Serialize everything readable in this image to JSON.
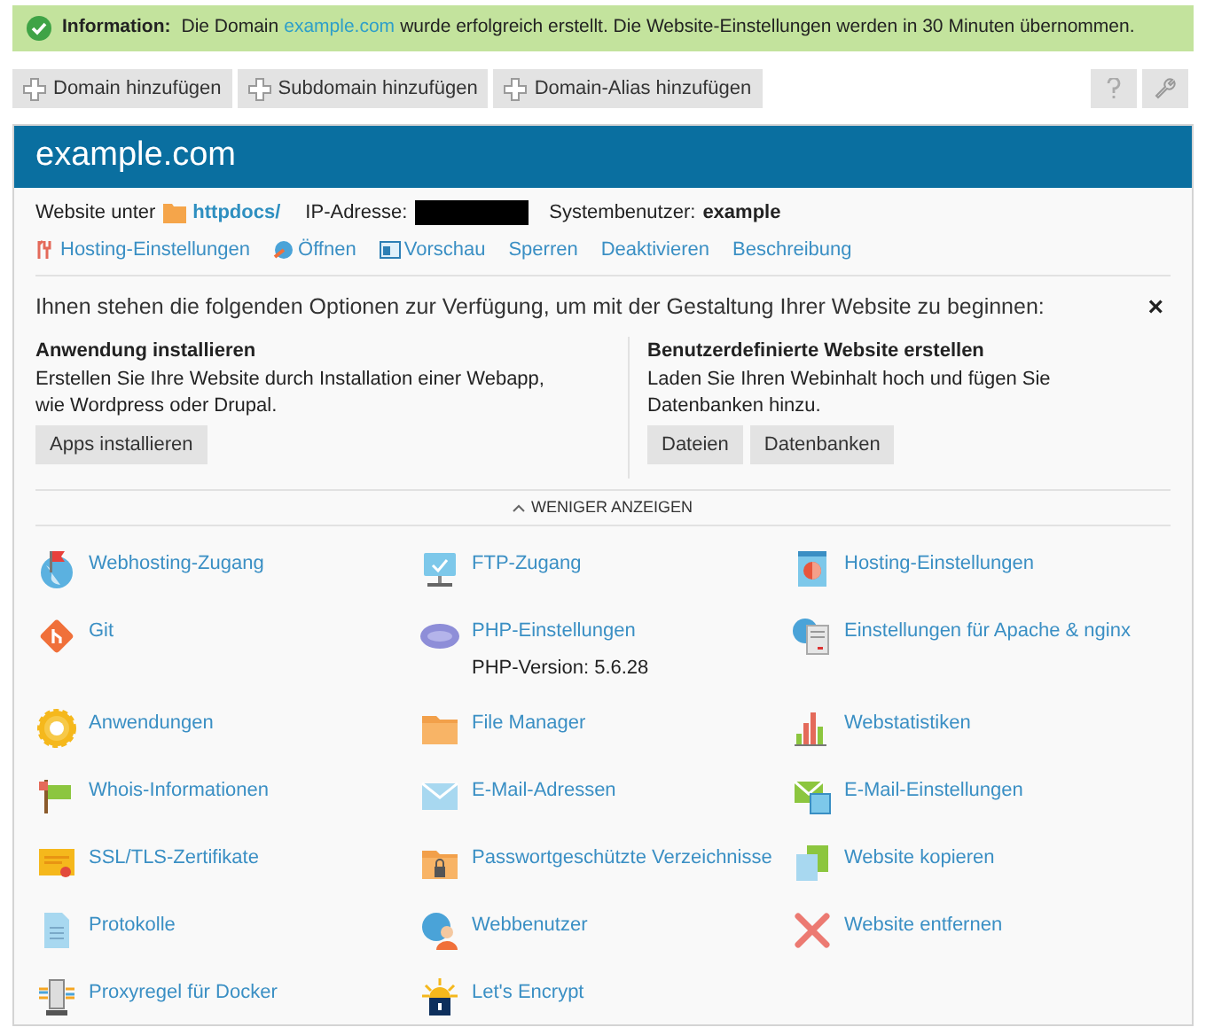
{
  "notice": {
    "label": "Information:",
    "before": "Die Domain",
    "link": "example.com",
    "after": "wurde erfolgreich erstellt. Die Website-Einstellungen werden in 30 Minuten übernommen."
  },
  "toolbar": [
    "Domain hinzufügen",
    "Subdomain hinzufügen",
    "Domain-Alias hinzufügen"
  ],
  "domain": {
    "title": "example.com",
    "website_label": "Website unter",
    "website_path": "httpdocs/",
    "ip_label": "IP-Adresse:",
    "user_label": "Systembenutzer:",
    "user": "example"
  },
  "actions": [
    "Hosting-Einstellungen",
    "Öffnen",
    "Vorschau",
    "Sperren",
    "Deaktivieren",
    "Beschreibung"
  ],
  "options": {
    "intro": "Ihnen stehen die folgenden Optionen zur Verfügung, um mit der Gestaltung Ihrer Website zu beginnen:",
    "close": "×",
    "left": {
      "title": "Anwendung installieren",
      "text": "Erstellen Sie Ihre Website durch Installation einer Webapp, wie Wordpress oder Drupal.",
      "buttons": [
        "Apps installieren"
      ]
    },
    "right": {
      "title": "Benutzerdefinierte Website erstellen",
      "text": "Laden Sie Ihren Webinhalt hoch und fügen Sie Datenbanken hinzu.",
      "buttons": [
        "Dateien",
        "Datenbanken"
      ]
    },
    "toggle": "WENIGER ANZEIGEN"
  },
  "tools": [
    {
      "label": "Webhosting-Zugang"
    },
    {
      "label": "FTP-Zugang"
    },
    {
      "label": "Hosting-Einstellungen"
    },
    {
      "label": "Git"
    },
    {
      "label": "PHP-Einstellungen",
      "note": "PHP-Version: 5.6.28"
    },
    {
      "label": "Einstellungen für Apache & nginx"
    },
    {
      "label": "Anwendungen"
    },
    {
      "label": "File Manager"
    },
    {
      "label": "Webstatistiken"
    },
    {
      "label": "Whois-Informationen"
    },
    {
      "label": "E-Mail-Adressen"
    },
    {
      "label": "E-Mail-Einstellungen"
    },
    {
      "label": "SSL/TLS-Zertifikate"
    },
    {
      "label": "Passwortgeschützte Verzeichnisse"
    },
    {
      "label": "Website kopieren"
    },
    {
      "label": "Protokolle"
    },
    {
      "label": "Webbenutzer"
    },
    {
      "label": "Website entfernen"
    },
    {
      "label": "Proxyregel für Docker"
    },
    {
      "label": "Let's Encrypt"
    }
  ]
}
